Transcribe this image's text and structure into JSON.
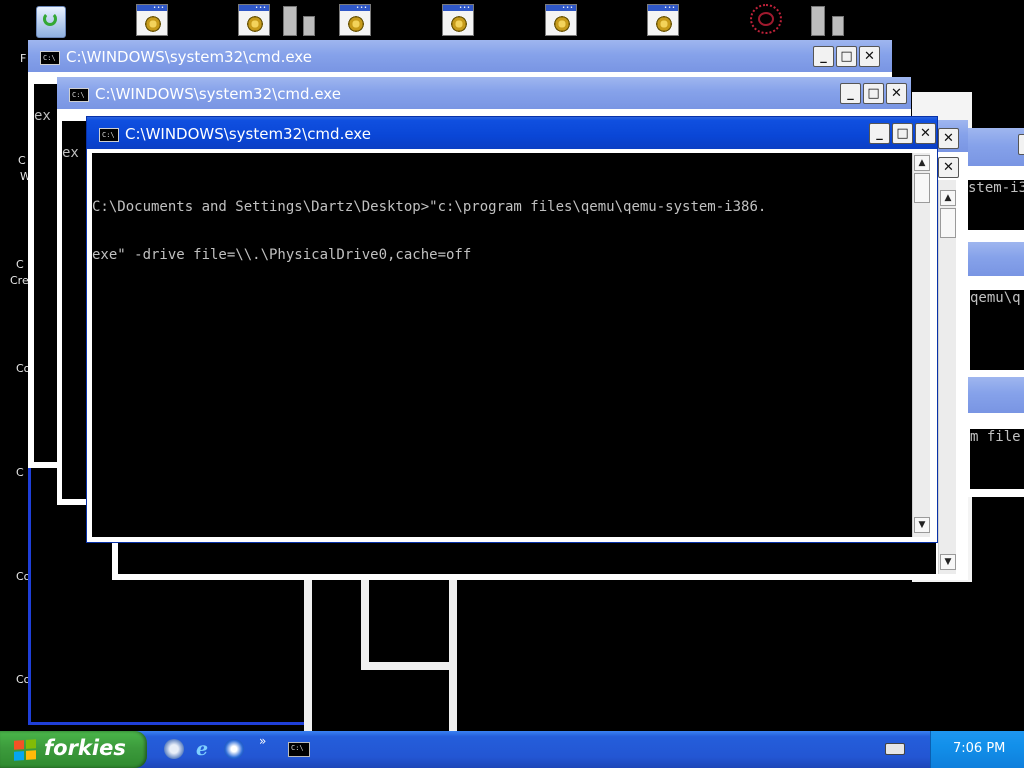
{
  "windows": [
    {
      "title": "C:\\WINDOWS\\system32\\cmd.exe",
      "state": "inactive"
    },
    {
      "title": "C:\\WINDOWS\\system32\\cmd.exe",
      "state": "inactive"
    },
    {
      "title": "C:\\WINDOWS\\system32\\cmd.exe",
      "state": "active"
    }
  ],
  "console": {
    "line1": "C:\\Documents and Settings\\Dartz\\Desktop>\"c:\\program files\\qemu\\qemu-system-i386.",
    "line2": "exe\" -drive file=\\\\.\\PhysicalDrive0,cache=off",
    "partial_back_1": "C:",
    "partial_back_2": "ex",
    "partial_right_1": "stem-i3",
    "partial_right_2": "qemu\\q",
    "partial_right_3": "m file"
  },
  "title_buttons": {
    "minimize": "_",
    "maximize": "□",
    "close": "✕"
  },
  "desktop_labels": [
    "F",
    "C",
    "W",
    "C",
    "Cre",
    "Co",
    "C",
    "Co",
    "Co"
  ],
  "taskbar": {
    "start_label": "forkies",
    "task_icon_text": "C:\\",
    "quicklaunch_more": "»",
    "clock": "7:06 PM"
  },
  "colors": {
    "title_active": "#0a46d6",
    "title_inactive": "#86a2ea",
    "taskbar": "#245edb",
    "start": "#3c9b3c",
    "tray": "#1290ea"
  },
  "icons": [
    "recycle-bin-icon",
    "program-doc-icon",
    "folder-icon",
    "network-icon",
    "cmd-icon",
    "windows-flag-icon",
    "ie-icon",
    "media-player-icon",
    "keyboard-icon"
  ]
}
